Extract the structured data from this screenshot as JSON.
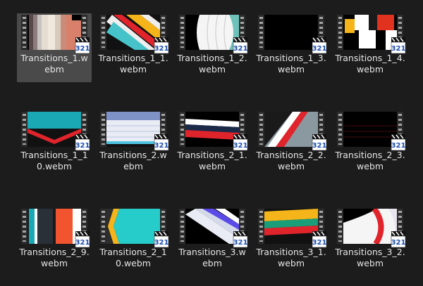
{
  "app": {
    "view": "file-explorer-large-icons"
  },
  "files": [
    {
      "name": "Transitions_1.webm",
      "selected": true
    },
    {
      "name": "Transitions_1_1.webm"
    },
    {
      "name": "Transitions_1_2.webm"
    },
    {
      "name": "Transitions_1_3.webm"
    },
    {
      "name": "Transitions_1_4.webm"
    },
    {
      "name": "Transitions_1_10.webm"
    },
    {
      "name": "Transitions_2.webm"
    },
    {
      "name": "Transitions_2_1.webm"
    },
    {
      "name": "Transitions_2_2.webm"
    },
    {
      "name": "Transitions_2_3.webm"
    },
    {
      "name": "Transitions_2_9.webm"
    },
    {
      "name": "Transitions_2_10.webm"
    },
    {
      "name": "Transitions_3.webm"
    },
    {
      "name": "Transitions_3_1.webm"
    },
    {
      "name": "Transitions_3_2.webm"
    }
  ],
  "colors": {
    "background": "#1c1c1c",
    "selection": "#4a4a4a",
    "text": "#e6e6e6"
  },
  "icons": {
    "overlay": "media-player-badge-icon"
  }
}
